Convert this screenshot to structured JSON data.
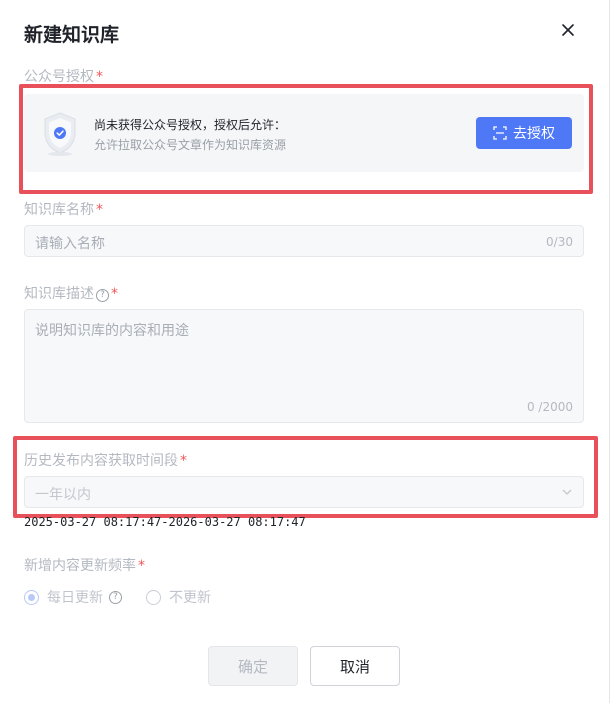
{
  "dialog": {
    "title": "新建知识库",
    "close_icon": "close-icon"
  },
  "auth": {
    "label": "公众号授权",
    "required_mark": "*",
    "title": "尚未获得公众号授权，授权后允许：",
    "subtitle": "允许拉取公众号文章作为知识库资源",
    "button_label": "去授权",
    "button_icon": "scan-icon",
    "shield_icon": "shield-icon"
  },
  "name": {
    "label": "知识库名称",
    "required_mark": "*",
    "placeholder": "请输入名称",
    "counter": "0/30"
  },
  "description": {
    "label": "知识库描述",
    "help_icon": "?",
    "required_mark": "*",
    "placeholder": "说明知识库的内容和用途",
    "counter": "0 /2000"
  },
  "history": {
    "label": "历史发布内容获取时间段",
    "required_mark": "*",
    "selected_value": "一年以内",
    "range_text": "2025-03-27 08:17:47-2026-03-27 08:17:47"
  },
  "frequency": {
    "label": "新增内容更新频率",
    "required_mark": "*",
    "options": [
      {
        "label": "每日更新",
        "checked": true,
        "help_icon": "?"
      },
      {
        "label": "不更新",
        "checked": false
      }
    ]
  },
  "footer": {
    "confirm_label": "确定",
    "cancel_label": "取消"
  },
  "colors": {
    "primary": "#4f78f7",
    "highlight_outline": "#e85159",
    "required": "#f25757"
  }
}
